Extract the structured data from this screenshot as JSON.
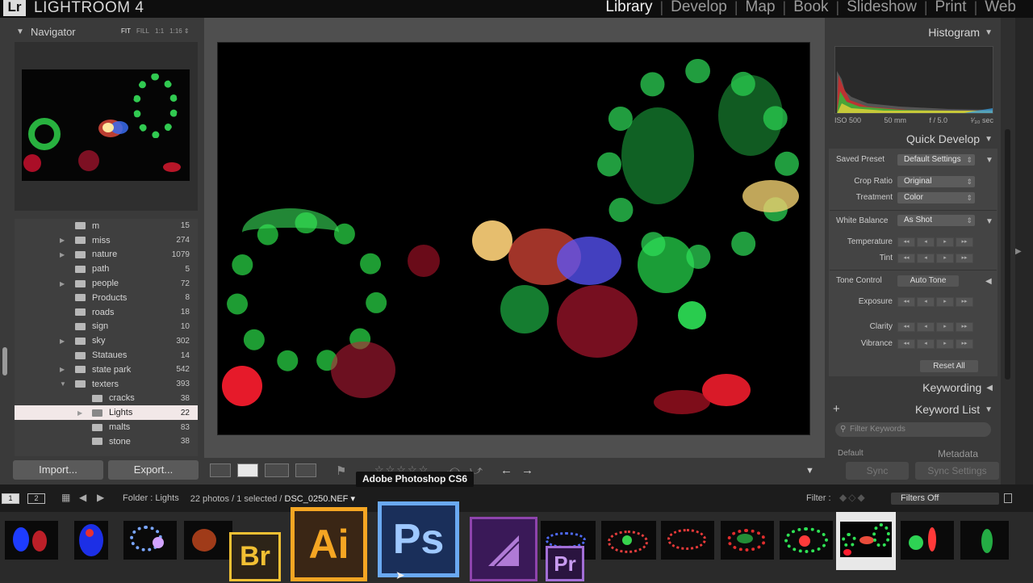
{
  "app": {
    "logo": "Lr",
    "title": "LIGHTROOM 4",
    "modules": [
      "Library",
      "Develop",
      "Map",
      "Book",
      "Slideshow",
      "Print",
      "Web"
    ],
    "active_module": "Library"
  },
  "navigator": {
    "title": "Navigator",
    "modes": [
      "FIT",
      "FILL",
      "1:1",
      "1:16 ⇕"
    ]
  },
  "folders": [
    {
      "name": "m",
      "count": "15",
      "expand": ""
    },
    {
      "name": "miss",
      "count": "274",
      "expand": "▶"
    },
    {
      "name": "nature",
      "count": "1079",
      "expand": "▶"
    },
    {
      "name": "path",
      "count": "5",
      "expand": ""
    },
    {
      "name": "people",
      "count": "72",
      "expand": "▶"
    },
    {
      "name": "Products",
      "count": "8",
      "expand": ""
    },
    {
      "name": "roads",
      "count": "18",
      "expand": ""
    },
    {
      "name": "sign",
      "count": "10",
      "expand": ""
    },
    {
      "name": "sky",
      "count": "302",
      "expand": "▶"
    },
    {
      "name": "Stataues",
      "count": "14",
      "expand": ""
    },
    {
      "name": "state park",
      "count": "542",
      "expand": "▶"
    },
    {
      "name": "texters",
      "count": "393",
      "expand": "▼"
    },
    {
      "name": "cracks",
      "count": "38",
      "expand": "",
      "sub": true
    },
    {
      "name": "Lights",
      "count": "22",
      "expand": "▶",
      "sub": true,
      "selected": true
    },
    {
      "name": "malts",
      "count": "83",
      "expand": "",
      "sub": true
    },
    {
      "name": "stone",
      "count": "38",
      "expand": "",
      "sub": true
    }
  ],
  "buttons": {
    "import": "Import...",
    "export": "Export..."
  },
  "right": {
    "histogram": "Histogram",
    "hist_meta": [
      "ISO 500",
      "50 mm",
      "f / 5.0",
      "¹⁄₃₀ sec"
    ],
    "quick_develop": "Quick Develop",
    "saved_preset_label": "Saved Preset",
    "saved_preset_value": "Default Settings",
    "crop_ratio_label": "Crop Ratio",
    "crop_ratio_value": "Original",
    "treatment_label": "Treatment",
    "treatment_value": "Color",
    "white_balance_label": "White Balance",
    "white_balance_value": "As Shot",
    "temperature_label": "Temperature",
    "tint_label": "Tint",
    "tone_control_label": "Tone Control",
    "auto_tone": "Auto Tone",
    "exposure_label": "Exposure",
    "clarity_label": "Clarity",
    "vibrance_label": "Vibrance",
    "reset_all": "Reset All",
    "keywording": "Keywording",
    "keyword_list": "Keyword List",
    "filter_keywords_placeholder": "Filter Keywords",
    "default_label": "Default",
    "metadata": "Metadata",
    "sync": "Sync",
    "sync_settings": "Sync Settings",
    "stepper_glyphs": [
      "◂◂",
      "◂",
      "▸",
      "▸▸"
    ]
  },
  "filmstrip": {
    "screen1": "1",
    "screen2": "2",
    "folder_label": "Folder : Lights",
    "photo_count": "22 photos / 1 selected /",
    "file_name": "DSC_0250.NEF ▾",
    "filter_label": "Filter :",
    "filters_off": "Filters Off"
  },
  "dock": {
    "tooltip": "Adobe Photoshop CS6",
    "apps": [
      "Br",
      "Ai",
      "Ps",
      "Pr"
    ]
  },
  "colors": {
    "accent_ps": "#2c5ea8",
    "accent_ai": "#f5a623",
    "accent_br": "#f2c033",
    "accent_pr": "#8e44ad",
    "selected_folder_bg": "#f2e8e8"
  }
}
